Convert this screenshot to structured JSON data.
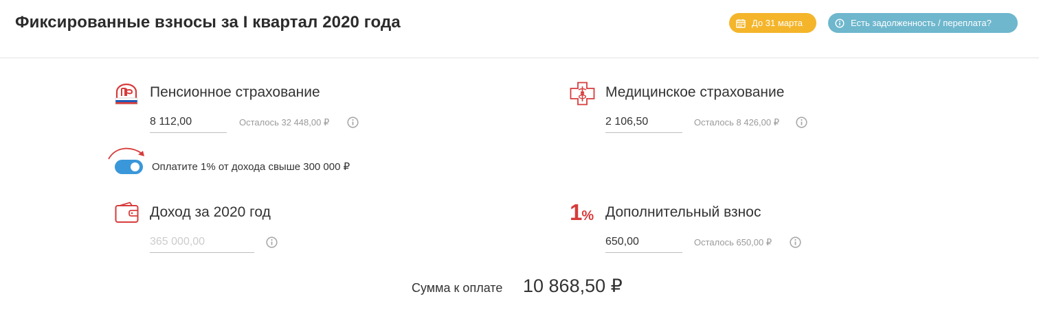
{
  "header": {
    "title": "Фиксированные взносы за I квартал 2020 года",
    "deadline_badge": "До 31 марта",
    "debt_badge": "Есть задолженность / переплата?",
    "deadline_badge_color": "#f4b52b",
    "debt_badge_color": "#6eb7cd"
  },
  "pension": {
    "title": "Пенсионное страхование",
    "value": "8 112,00",
    "remaining": "Осталось 32 448,00 ₽",
    "icon": "pfr-logo-icon"
  },
  "medical": {
    "title": "Медицинское страхование",
    "value": "2 106,50",
    "remaining": "Осталось 8 426,00 ₽",
    "icon": "medical-cross-icon"
  },
  "toggle": {
    "label": "Оплатите 1% от дохода свыше 300 000 ₽",
    "checked": true,
    "color": "#3a97d9"
  },
  "income": {
    "title": "Доход за 2020 год",
    "placeholder": "365 000,00",
    "icon": "wallet-icon"
  },
  "additional": {
    "title": "Дополнительный взнос",
    "badge_big": "1",
    "badge_small": "%",
    "value": "650,00",
    "remaining": "Осталось 650,00 ₽",
    "accent_color": "#d73b3b"
  },
  "total": {
    "label": "Сумма к оплате",
    "value": "10 868,50 ₽"
  }
}
